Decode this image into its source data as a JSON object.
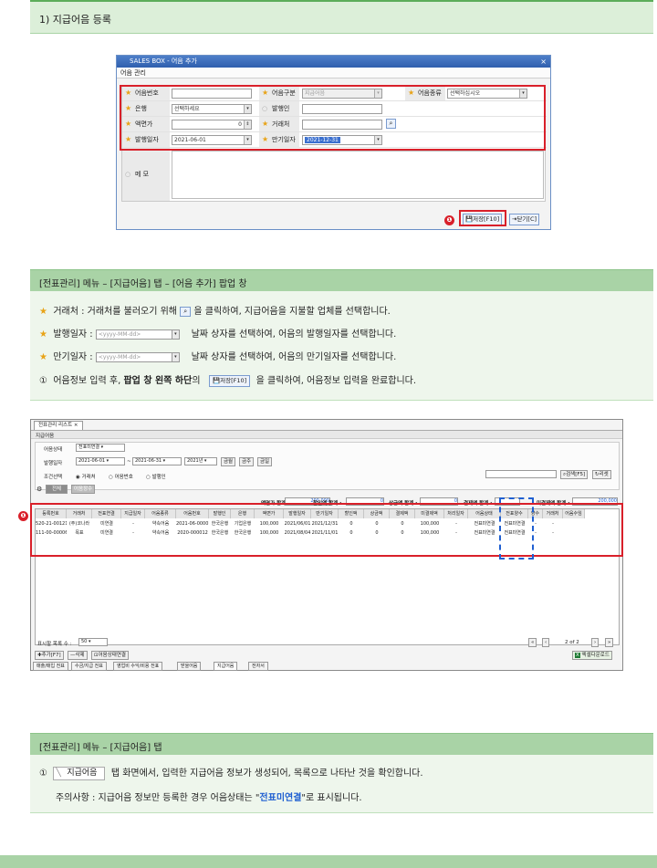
{
  "top_heading": "1) 지급어음 등록",
  "dialog": {
    "title": "SALES BOX - 어음 추가",
    "section": "어음 관리",
    "fields": {
      "note_no_label": "어음번호",
      "note_type_label": "어음구분",
      "note_type_value": "지급어음",
      "note_kind_label": "어음종류",
      "note_kind_value": "선택하십시오",
      "bank_label": "은행",
      "bank_value": "선택하세요",
      "issuer_label": "발행인",
      "face_label": "액면가",
      "face_value": "0",
      "partner_label": "거래처",
      "issue_date_label": "발행일자",
      "issue_date_value": "2021-06-01",
      "due_date_label": "만기일자",
      "due_date_value": "2021-12-31",
      "memo_label": "메 모"
    },
    "save_button": "저장[F10]",
    "close_button": "닫기[C]",
    "badge": "❶"
  },
  "section1": {
    "bar": "[전표관리] 메뉴 – [지급어음] 탭 – [어음 추가] 팝업 창",
    "line1_a": "거래처  : 거래처를 불러오기 위해",
    "line1_b": "을 클릭하여, 지급어음을 지불할 업체를 선택합니다.",
    "line2_a": "발행일자 :",
    "line2_b": "날짜 상자를 선택하여, 어음의 발행일자를 선택합니다.",
    "line3_a": "만기일자 :",
    "line3_b": "날짜 상자를 선택하여, 어음의 만기일자를 선택합니다.",
    "date_placeholder": "<yyyy-MM-dd>",
    "line4_num": "①",
    "line4_a": "어음정보 입력 후,",
    "line4_bold": "팝업 창 왼쪽 하단",
    "line4_b": "의",
    "line4_btn": "저장[F10]",
    "line4_c": "을 클릭하여, 어음정보 입력을 완료합니다."
  },
  "win": {
    "tab": "전표관리 리스트",
    "sub_tab": "지급어음",
    "status_label": "어음상태",
    "status_value": "전표미연결",
    "date_label": "발행일자",
    "date_from": "2021-06-01",
    "date_to": "2021-06-31",
    "year": "2021년",
    "btn_today": "금월",
    "btn_quarter": "금주",
    "btn_month": "금일",
    "cond_label": "조건선택",
    "radio1": "거래처",
    "radio2": "어음번호",
    "radio3": "발행인",
    "search_btn": "검색[F5]",
    "reset_btn": "리셋",
    "chip1": "전체",
    "chip2": "어음장수",
    "sum1_label": "액면가 합계 :",
    "sum1_value": "200,000",
    "sum2_label": "할인액 합계 :",
    "sum2_value": "0",
    "sum3_label": "상금액 합계 :",
    "sum3_value": "0",
    "sum4_label": "결제액 합계 :",
    "sum4_value": "",
    "sum5_label": "미결제액 합계 :",
    "sum5_value": "200,000",
    "columns": [
      "등록번호",
      "거래처",
      "전표연결",
      "지급일자",
      "어음종류",
      "어음번호",
      "발행인",
      "은행",
      "액면가",
      "발행일자",
      "만기일자",
      "할인액",
      "상금액",
      "결제액",
      "미결제액",
      "처리일자",
      "어음상태",
      "전표양수",
      "양수",
      "거래처",
      "어음수임"
    ],
    "rows": [
      [
        "520-21-00121",
        "(주)코나라",
        "미연결",
        "-",
        "약속어음",
        "2021-06-00001",
        "한국은행",
        "기업은행",
        "100,000",
        "2021/06/01",
        "2021/12/31",
        "0",
        "0",
        "0",
        "100,000",
        "-",
        "전표미연결",
        "전표미연결",
        "-",
        "-",
        ""
      ],
      [
        "111-00-00006",
        "목표",
        "미연결",
        "-",
        "약속어음",
        "2020-000012",
        "한국은행",
        "한국은행",
        "100,000",
        "2021/08/04",
        "2021/11/01",
        "0",
        "0",
        "0",
        "100,000",
        "-",
        "전표미연결",
        "전표미연결",
        "-",
        "-",
        ""
      ]
    ],
    "page_size_label": "표시할 목록 수 :",
    "page_size": "50",
    "page_info": "2 of 2",
    "add_btn": "추가[F7]",
    "del_btn": "삭제",
    "link_btn": "어음상태연결",
    "excel_btn": "엑셀다운로드",
    "bottom_tabs": [
      "매출/매입 전표",
      "수금/지급 전표",
      "영업비 수익/비용 전표",
      "받을어음",
      "지급어음",
      "전자서"
    ],
    "badge": "❶"
  },
  "section2": {
    "bar": "[전표관리] 메뉴 – [지급어음] 탭",
    "line1_num": "①",
    "tab_label": "지급어음",
    "line1_b": "탭 화면에서, 입력한 지급어음 정보가 생성되어, 목록으로 나타난 것을 확인합니다.",
    "line2_a": "주의사항 :  지급어음 정보만 등록한 경우 어음상태는 \"",
    "line2_hl": "전표미연결",
    "line2_b": "\"로 표시됩니다."
  },
  "colors": {
    "accent_green": "#a9d3a6",
    "highlight_blue": "#1f5fd1",
    "red": "#d9202a"
  }
}
